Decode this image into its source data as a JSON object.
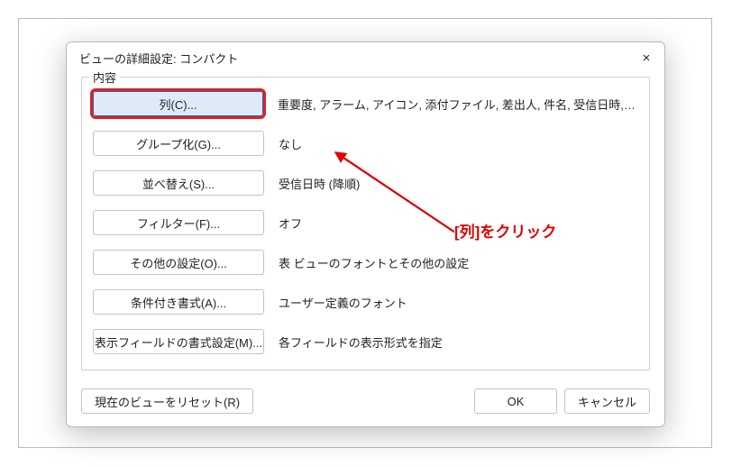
{
  "dialog": {
    "title": "ビューの詳細設定: コンパクト",
    "close_icon": "×",
    "group_label": "内容",
    "rows": [
      {
        "button": "列(C)...",
        "desc": "重要度, アラーム, アイコン, 添付ファイル, 差出人, 件名, 受信日時, サイ..."
      },
      {
        "button": "グループ化(G)...",
        "desc": "なし"
      },
      {
        "button": "並べ替え(S)...",
        "desc": "受信日時 (降順)"
      },
      {
        "button": "フィルター(F)...",
        "desc": "オフ"
      },
      {
        "button": "その他の設定(O)...",
        "desc": "表 ビューのフォントとその他の設定"
      },
      {
        "button": "条件付き書式(A)...",
        "desc": "ユーザー定義のフォント"
      },
      {
        "button": "表示フィールドの書式設定(M)...",
        "desc": "各フィールドの表示形式を指定"
      }
    ],
    "reset_label": "現在のビューをリセット(R)",
    "ok_label": "OK",
    "cancel_label": "キャンセル"
  },
  "annotation": {
    "text": "[列]をクリック",
    "color": "#e00000"
  }
}
